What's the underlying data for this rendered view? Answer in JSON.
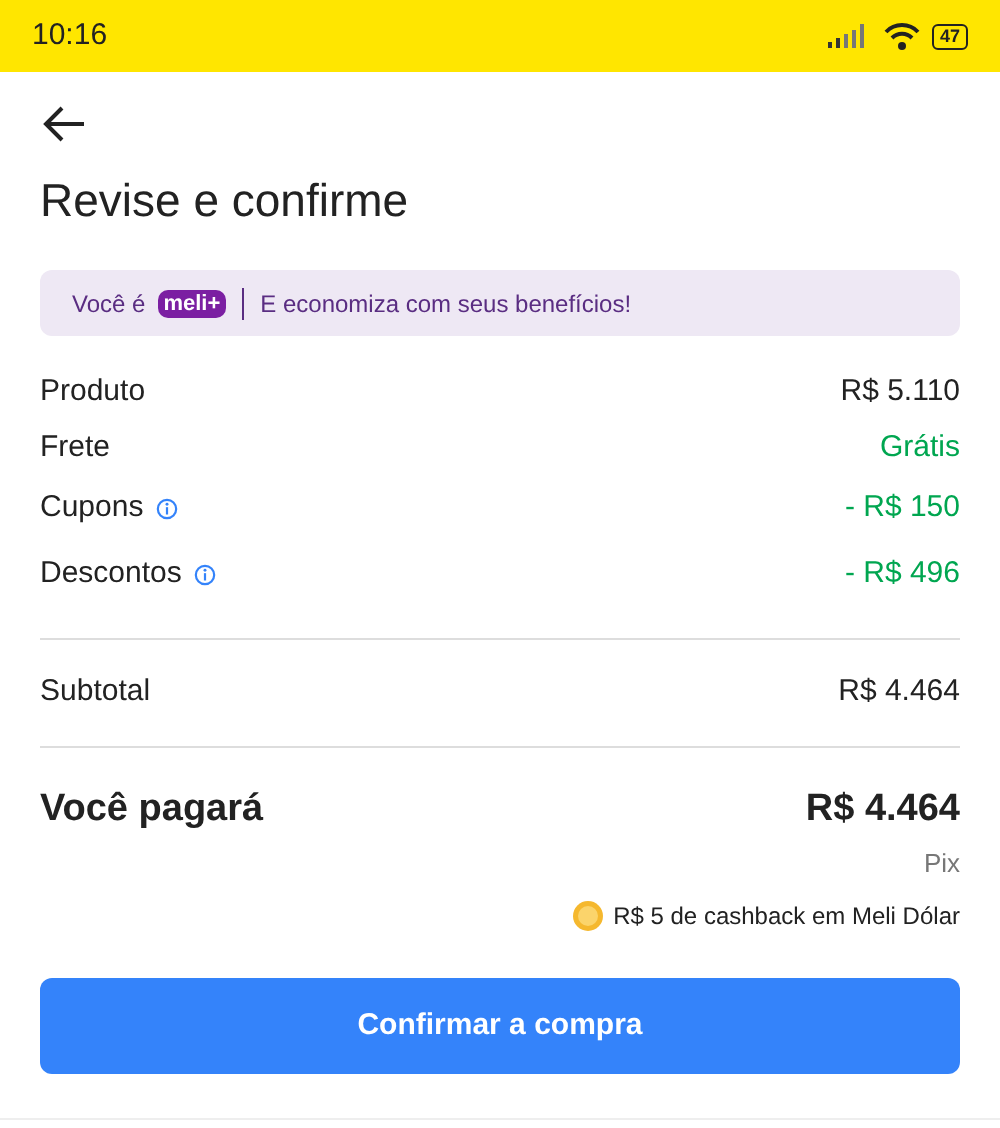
{
  "status_bar": {
    "time": "10:16",
    "battery": "47"
  },
  "title": "Revise e confirme",
  "banner": {
    "prefix": "Você é",
    "badge": "meli+",
    "message": "E economiza com seus benefícios!"
  },
  "lines": [
    {
      "label": "Produto",
      "value": "R$ 5.110",
      "kind": "charge",
      "info": false
    },
    {
      "label": "Frete",
      "value": "Grátis",
      "kind": "discount",
      "info": false
    },
    {
      "label": "Cupons",
      "value": "- R$ 150",
      "kind": "discount",
      "info": true
    },
    {
      "label": "Descontos",
      "value": "- R$ 496",
      "kind": "discount",
      "info": true
    }
  ],
  "subtotal": {
    "label": "Subtotal",
    "value": "R$ 4.464"
  },
  "total": {
    "label": "Você pagará",
    "value": "R$ 4.464",
    "method": "Pix",
    "cashback": "R$ 5 de cashback em Meli Dólar"
  },
  "confirm_button": "Confirmar a compra"
}
